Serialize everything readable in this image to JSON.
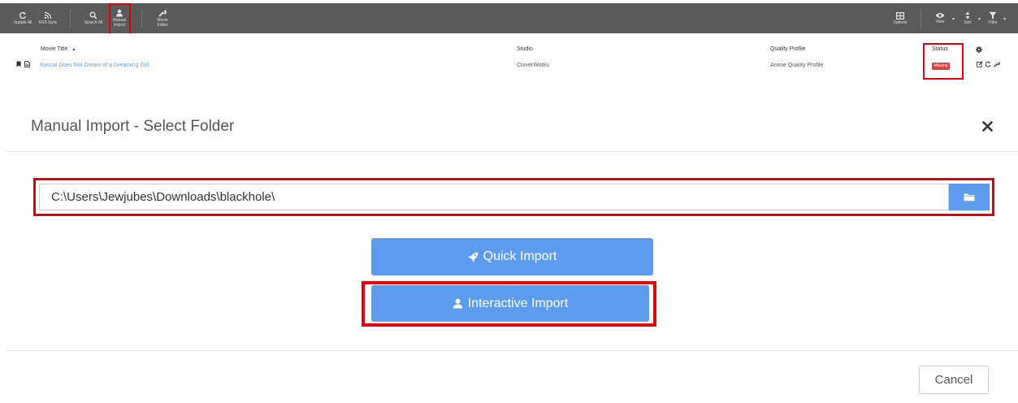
{
  "toolbar": {
    "update_all": "Update All",
    "rss_sync": "RSS Sync",
    "search_all": "Search All",
    "manual_import": "Manual\nImport",
    "movie_editor": "Movie\nEditor",
    "options": "Options",
    "view": "View",
    "sort": "Sort",
    "filter": "Filter"
  },
  "table": {
    "headers": {
      "title": "Movie Title",
      "title_sort": "▲",
      "studio": "Studio",
      "quality": "Quality Profile",
      "status": "Status"
    },
    "rows": [
      {
        "title": "Rascal Does Not Dream of a Dreaming Girl",
        "studio": "CloverWorks",
        "quality_profile": "Anime Quality Profile",
        "status": "Missing"
      }
    ]
  },
  "modal": {
    "title": "Manual Import - Select Folder",
    "path_value": "C:\\Users\\Jewjubes\\Downloads\\blackhole\\",
    "quick_import": "Quick Import",
    "interactive_import": "Interactive Import",
    "cancel": "Cancel"
  },
  "colors": {
    "accent": "#5d9cec",
    "toolbar_bg": "#5a5a5a",
    "missing": "#e23e3e",
    "highlight": "#e0000c"
  }
}
